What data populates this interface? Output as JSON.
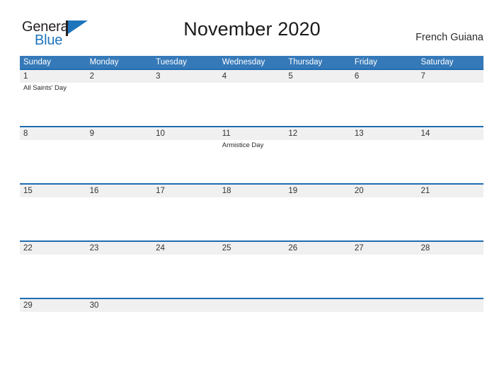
{
  "brand": {
    "name_top": "General",
    "name_bottom": "Blue",
    "accent_color": "#1d74bb",
    "dark_color": "#231f20",
    "flag_icon": "flag-triangle-icon"
  },
  "header": {
    "title": "November 2020",
    "region": "French Guiana"
  },
  "colors": {
    "weekday_header_bg": "#3579b8",
    "weekday_header_text": "#ffffff",
    "row_divider": "#1f6cb0",
    "date_band_bg": "#f0f0f0",
    "page_bg": "#ffffff"
  },
  "calendar": {
    "month": "November",
    "year": "2020",
    "weekday_headers": [
      "Sunday",
      "Monday",
      "Tuesday",
      "Wednesday",
      "Thursday",
      "Friday",
      "Saturday"
    ],
    "weeks": [
      {
        "days": [
          {
            "num": "1",
            "event": "All Saints' Day"
          },
          {
            "num": "2",
            "event": ""
          },
          {
            "num": "3",
            "event": ""
          },
          {
            "num": "4",
            "event": ""
          },
          {
            "num": "5",
            "event": ""
          },
          {
            "num": "6",
            "event": ""
          },
          {
            "num": "7",
            "event": ""
          }
        ]
      },
      {
        "days": [
          {
            "num": "8",
            "event": ""
          },
          {
            "num": "9",
            "event": ""
          },
          {
            "num": "10",
            "event": ""
          },
          {
            "num": "11",
            "event": "Armistice Day"
          },
          {
            "num": "12",
            "event": ""
          },
          {
            "num": "13",
            "event": ""
          },
          {
            "num": "14",
            "event": ""
          }
        ]
      },
      {
        "days": [
          {
            "num": "15",
            "event": ""
          },
          {
            "num": "16",
            "event": ""
          },
          {
            "num": "17",
            "event": ""
          },
          {
            "num": "18",
            "event": ""
          },
          {
            "num": "19",
            "event": ""
          },
          {
            "num": "20",
            "event": ""
          },
          {
            "num": "21",
            "event": ""
          }
        ]
      },
      {
        "days": [
          {
            "num": "22",
            "event": ""
          },
          {
            "num": "23",
            "event": ""
          },
          {
            "num": "24",
            "event": ""
          },
          {
            "num": "25",
            "event": ""
          },
          {
            "num": "26",
            "event": ""
          },
          {
            "num": "27",
            "event": ""
          },
          {
            "num": "28",
            "event": ""
          }
        ]
      },
      {
        "days": [
          {
            "num": "29",
            "event": ""
          },
          {
            "num": "30",
            "event": ""
          },
          {
            "num": "",
            "event": ""
          },
          {
            "num": "",
            "event": ""
          },
          {
            "num": "",
            "event": ""
          },
          {
            "num": "",
            "event": ""
          },
          {
            "num": "",
            "event": ""
          }
        ]
      }
    ]
  }
}
